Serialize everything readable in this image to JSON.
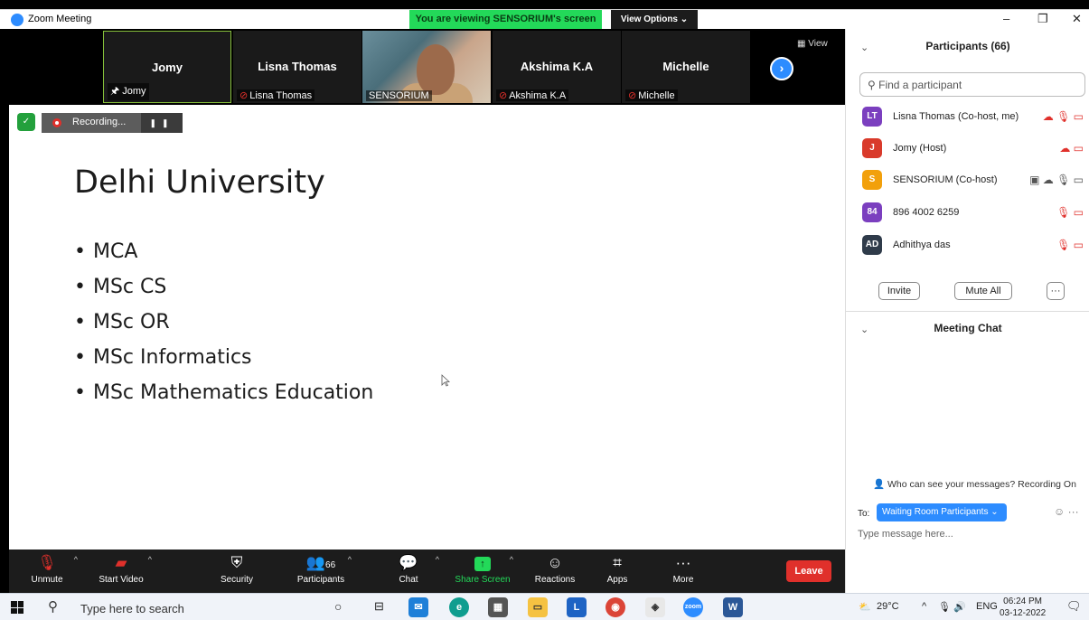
{
  "window": {
    "title": "Zoom Meeting",
    "viewing_banner": "You are viewing SENSORIUM's screen",
    "view_options": "View Options ⌄",
    "controls": [
      "–",
      "❐",
      "✕"
    ]
  },
  "thumbnails": [
    {
      "name": "Jomy",
      "label": "Jomy",
      "muted": false
    },
    {
      "name": "Lisna Thomas",
      "label": "Lisna Thomas",
      "muted": true
    },
    {
      "name": "",
      "label": "SENSORIUM",
      "muted": false
    },
    {
      "name": "Akshima K.A",
      "label": "Akshima K.A",
      "muted": true
    },
    {
      "name": "Michelle",
      "label": "Michelle",
      "muted": true
    }
  ],
  "view_label": "View",
  "recording": {
    "label": "Recording...",
    "controls": "❚❚ ■"
  },
  "slide": {
    "title": "Delhi University",
    "bullets": [
      "MCA",
      "MSc CS",
      "MSc OR",
      "MSc Informatics",
      "MSc Mathematics Education"
    ]
  },
  "toolbar": {
    "unmute": "Unmute",
    "start_video": "Start Video",
    "security": "Security",
    "participants": "Participants",
    "participants_count": "66",
    "chat": "Chat",
    "share_screen": "Share Screen",
    "reactions": "Reactions",
    "apps": "Apps",
    "more": "More",
    "leave": "Leave"
  },
  "panel": {
    "title": "Participants (66)",
    "search_placeholder": "Find a participant",
    "participants": [
      {
        "initials": "LT",
        "name": "Lisna Thomas (Co-host, me)",
        "color": "#7b3fbf",
        "icons": "☁ 🎙 ▭"
      },
      {
        "initials": "J",
        "name": "Jomy (Host)",
        "color": "#d93a2b",
        "icons": "☁ ▭"
      },
      {
        "initials": "S",
        "name": "SENSORIUM (Co-host)",
        "color": "#f2a00b",
        "icons": "▣ ☁ 🎙 ▭"
      },
      {
        "initials": "84",
        "name": "896 4002 6259",
        "color": "#7b3fbf",
        "icons": "🎙 ▭"
      },
      {
        "initials": "AD",
        "name": "Adhithya das",
        "color": "#2f3b4a",
        "icons": "🎙 ▭"
      }
    ],
    "invite": "Invite",
    "mute_all": "Mute All",
    "more": "···",
    "chat_title": "Meeting Chat",
    "who_can_see": "Who can see your messages? Recording On",
    "to_label": "To:",
    "to_value": "Waiting Room Participants ⌄",
    "message_placeholder": "Type message here..."
  },
  "taskbar": {
    "search": "Type here to search",
    "weather": "29°C",
    "lang": "ENG",
    "time": "06:24 PM",
    "date": "03-12-2022"
  }
}
